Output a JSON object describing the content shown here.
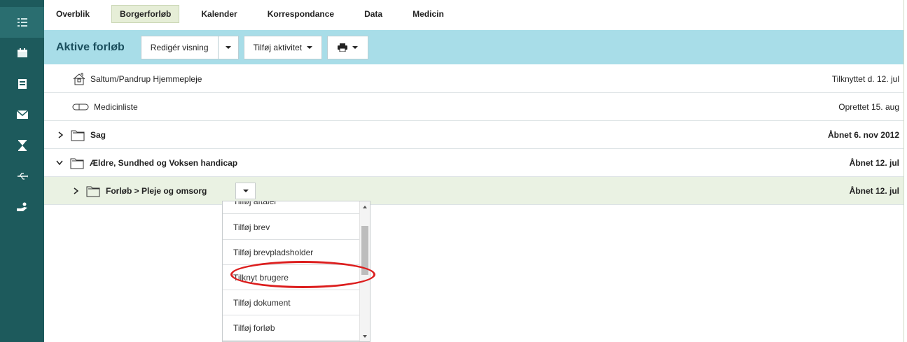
{
  "nav": {
    "tabs": [
      {
        "label": "Overblik"
      },
      {
        "label": "Borgerforløb",
        "active": true
      },
      {
        "label": "Kalender"
      },
      {
        "label": "Korrespondance"
      },
      {
        "label": "Data"
      },
      {
        "label": "Medicin"
      }
    ]
  },
  "sidebar": {
    "icons": [
      "list-icon",
      "calendar-icon",
      "binder-icon",
      "mail-icon",
      "hourglass-icon",
      "usb-icon",
      "hand-coin-icon"
    ]
  },
  "toolbar": {
    "title": "Aktive forløb",
    "edit_view_label": "Redigér visning",
    "add_activity_label": "Tilføj aktivitet"
  },
  "rows": [
    {
      "label": "Saltum/Pandrup Hjemmepleje",
      "right": "Tilknyttet d. 12. jul",
      "icon": "house-icon"
    },
    {
      "label": "Medicinliste",
      "right": "Oprettet 15. aug",
      "icon": "pill-icon"
    },
    {
      "label": "Sag",
      "right": "Åbnet 6. nov 2012",
      "icon": "folder-icon",
      "expanded": false
    },
    {
      "label": "Ældre, Sundhed og Voksen handicap",
      "right": "Åbnet 12. jul",
      "icon": "folder-icon",
      "expanded": true
    },
    {
      "label": "Forløb > Pleje og omsorg",
      "right": "Åbnet 12. jul",
      "icon": "folder-icon",
      "expanded": false
    }
  ],
  "menu": {
    "items": [
      {
        "label": "Tilføj aftaler"
      },
      {
        "label": "Tilføj brev"
      },
      {
        "label": "Tilføj brevpladsholder"
      },
      {
        "label": "Tilknyt brugere"
      },
      {
        "label": "Tilføj dokument"
      },
      {
        "label": "Tilføj forløb"
      }
    ]
  },
  "colors": {
    "sidebar": "#1d5a5c",
    "toolbar": "#a8dde8",
    "highlight_row": "#eaf2e3",
    "annotation": "#dc1e1e"
  }
}
